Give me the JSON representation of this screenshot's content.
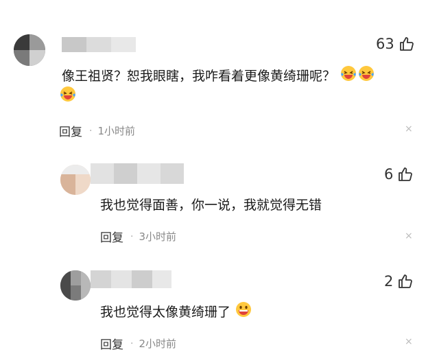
{
  "comments": [
    {
      "likes": "63",
      "text": "像王祖贤？恕我眼瞎，我咋看着更像黄绮珊呢？",
      "emojis": [
        "laughing-crying-emoji",
        "laughing-crying-emoji",
        "laughing-crying-emoji"
      ],
      "reply_label": "回复",
      "separator": "·",
      "time": "1小时前",
      "close": "×"
    },
    {
      "likes": "6",
      "text": "我也觉得面善，你一说，我就觉得无错",
      "reply_label": "回复",
      "separator": "·",
      "time": "3小时前",
      "close": "×"
    },
    {
      "likes": "2",
      "text": "我也觉得太像黄绮珊了",
      "emojis": [
        "grinning-emoji"
      ],
      "reply_label": "回复",
      "separator": "·",
      "time": "2小时前",
      "close": "×"
    }
  ],
  "colors": {
    "text": "#1a1a1a",
    "meta": "#888888",
    "emoji_face": "#ffc83d",
    "emoji_tears": "#4aa3ff",
    "emoji_mouth": "#e0423a"
  }
}
